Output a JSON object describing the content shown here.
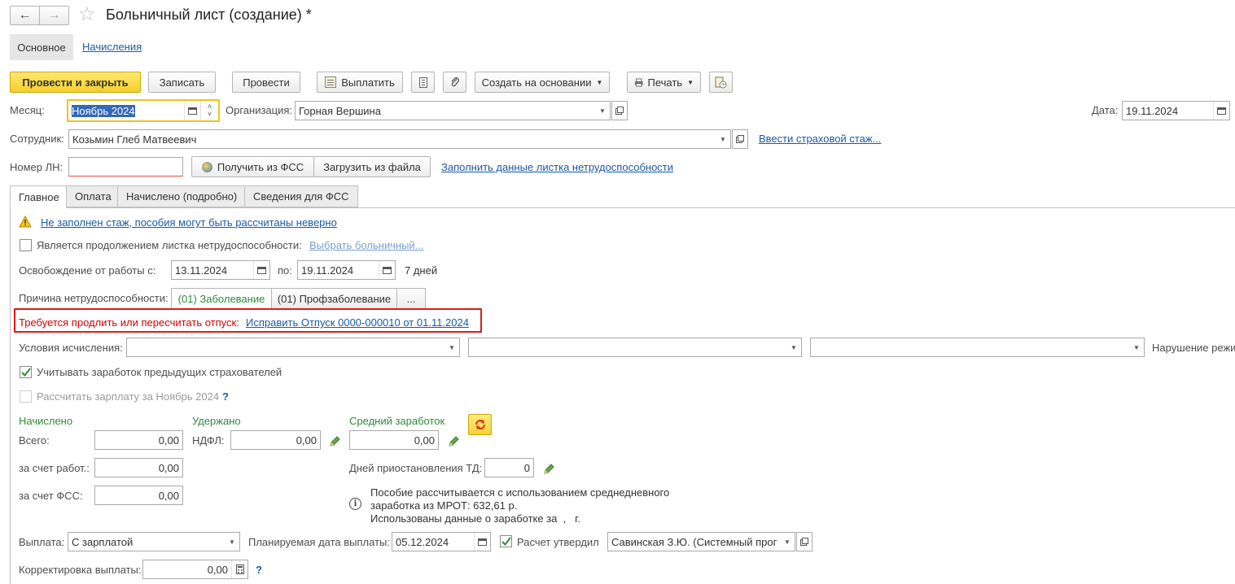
{
  "title": "Больничный лист (создание) *",
  "nav_tabs": {
    "main": "Основное",
    "charges": "Начисления"
  },
  "toolbar": {
    "post_close": "Провести и закрыть",
    "save": "Записать",
    "post": "Провести",
    "pay": "Выплатить",
    "create_based": "Создать на основании",
    "print": "Печать"
  },
  "header": {
    "month_label": "Месяц:",
    "month_value": "Ноябрь 2024",
    "org_label": "Организация:",
    "org_value": "Горная Вершина",
    "date_label": "Дата:",
    "date_value": "19.11.2024",
    "employee_label": "Сотрудник:",
    "employee_value": "Козьмин Глеб Матвеевич",
    "insurance_link": "Ввести страховой стаж...",
    "ln_label": "Номер ЛН:",
    "ln_value": "",
    "get_fss": "Получить из ФСС",
    "load_file": "Загрузить из файла",
    "fill_link": "Заполнить данные листка нетрудоспособности"
  },
  "tabs": {
    "main": "Главное",
    "payment": "Оплата",
    "charged": "Начислено (подробно)",
    "fss": "Сведения для ФСС"
  },
  "main": {
    "warning": "Не заполнен стаж, пособия могут быть рассчитаны неверно",
    "continuation_label": "Является продолжением листка нетрудоспособности:",
    "choose_sick": "Выбрать больничный...",
    "release_label": "Освобождение от работы с:",
    "release_from": "13.11.2024",
    "to_label": "по:",
    "release_to": "19.11.2024",
    "days": "7 дней",
    "reason_label": "Причина нетрудоспособности:",
    "reason_1": "(01) Заболевание",
    "reason_2": "(01) Профзаболевание",
    "reason_more": "...",
    "alert_text": "Требуется продлить или пересчитать отпуск:",
    "alert_link": "Исправить Отпуск 0000-000010 от 01.11.2024",
    "conditions_label": "Условия исчисления:",
    "violation_label": "Нарушение режи",
    "prev_earnings": "Учитывать заработок предыдущих страхователей",
    "calc_salary": "Рассчитать зарплату за Ноябрь 2024",
    "help": "?"
  },
  "totals": {
    "charged_head": "Начислено",
    "withheld_head": "Удержано",
    "avg_head": "Средний заработок",
    "total_label": "Всего:",
    "total_value": "0,00",
    "ndfl_label": "НДФЛ:",
    "ndfl_value": "0,00",
    "avg_value": "0,00",
    "employer_label": "за счет работ.:",
    "employer_value": "0,00",
    "fss_label": "за счет ФСС:",
    "fss_value": "0,00",
    "suspend_label": "Дней приостановления ТД:",
    "suspend_value": "0",
    "info_1": "Пособие рассчитывается с использованием среднедневного",
    "info_2": "заработка из МРОТ: 632,61 р.",
    "info_3": "Использованы данные о заработке за  ,   г."
  },
  "footer": {
    "payout_label": "Выплата:",
    "payout_value": "С зарплатой",
    "planned_label": "Планируемая дата выплаты:",
    "planned_value": "05.12.2024",
    "approved_label": "Расчет утвердил",
    "approver": "Савинская З.Ю. (Системный прог",
    "correction_label": "Корректировка выплаты:",
    "correction_value": "0,00",
    "help": "?"
  },
  "colors": {
    "accent_yellow": "#f5cf2a",
    "link": "#1a5aa6",
    "green": "#2e8b3a",
    "alert_red": "#d40000"
  }
}
